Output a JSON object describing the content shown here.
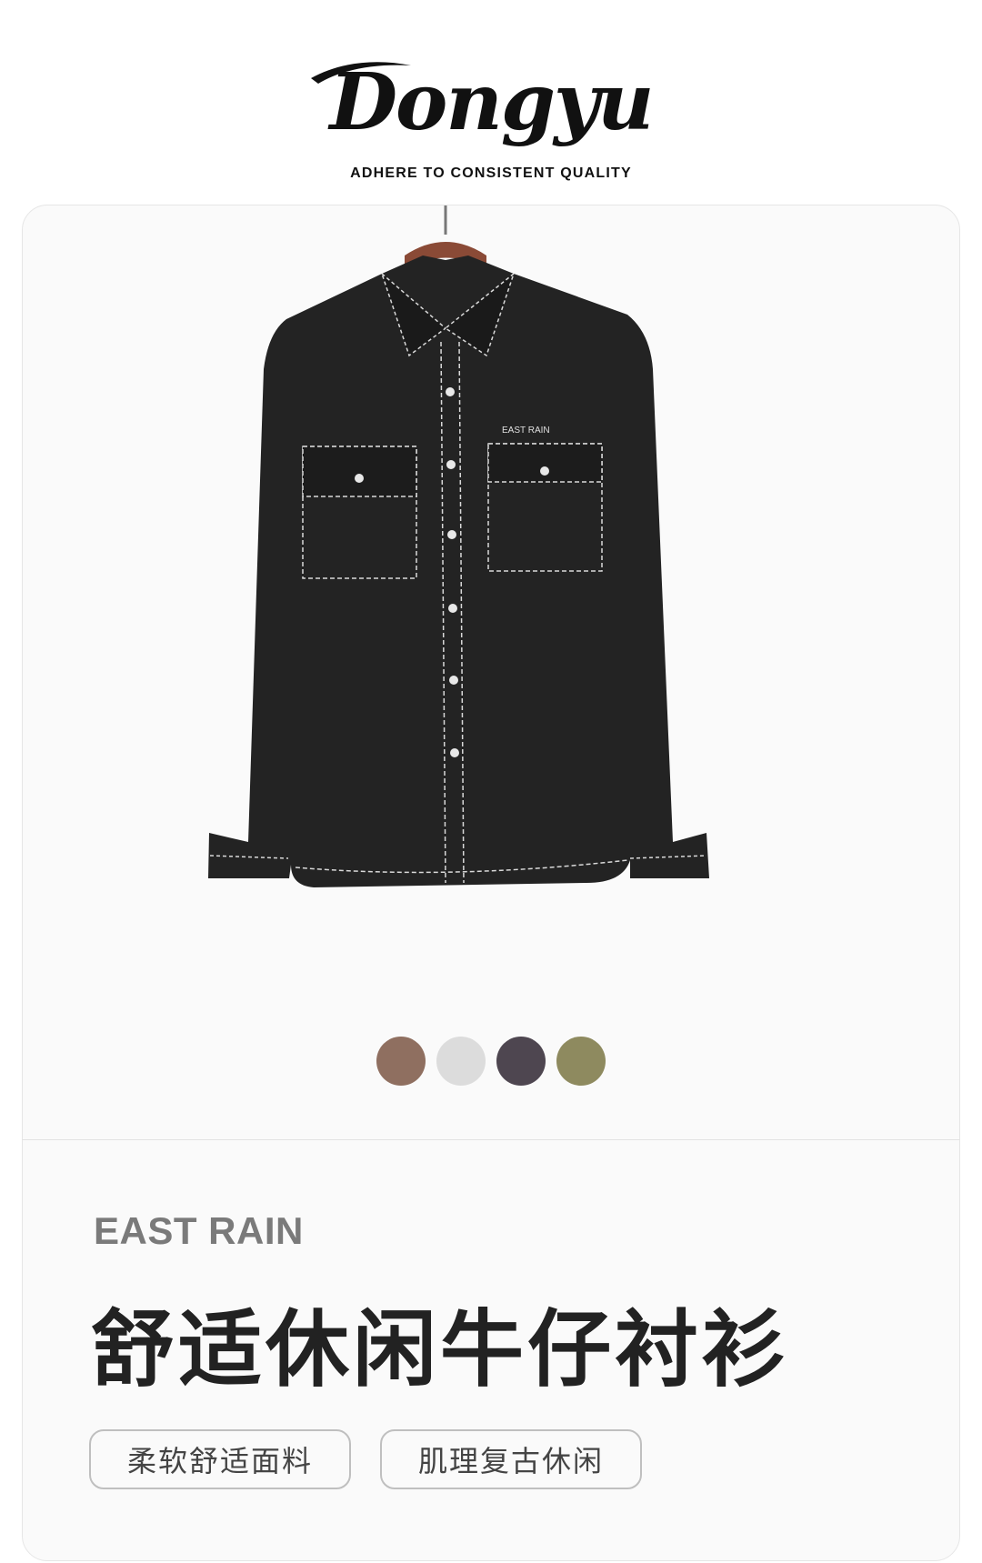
{
  "brand": {
    "logo_text": "Dongyu",
    "tagline": "ADHERE TO CONSISTENT QUALITY"
  },
  "product": {
    "image_alt_label": "EAST RAIN",
    "brand_name": "EAST RAIN",
    "title": "舒适休闲牛仔衬衫",
    "tags": [
      "柔软舒适面料",
      "肌理复古休闲"
    ],
    "swatches": [
      {
        "name": "brown-swatch",
        "color": "#8f6f60"
      },
      {
        "name": "light-gray-swatch",
        "color": "#dcdcdc"
      },
      {
        "name": "charcoal-purple-swatch",
        "color": "#4e4650"
      },
      {
        "name": "olive-swatch",
        "color": "#8e8a5f"
      }
    ]
  },
  "colors": {
    "shirt": "#232323",
    "stitch": "#d9d9d9",
    "hanger": "#8a4a36"
  }
}
